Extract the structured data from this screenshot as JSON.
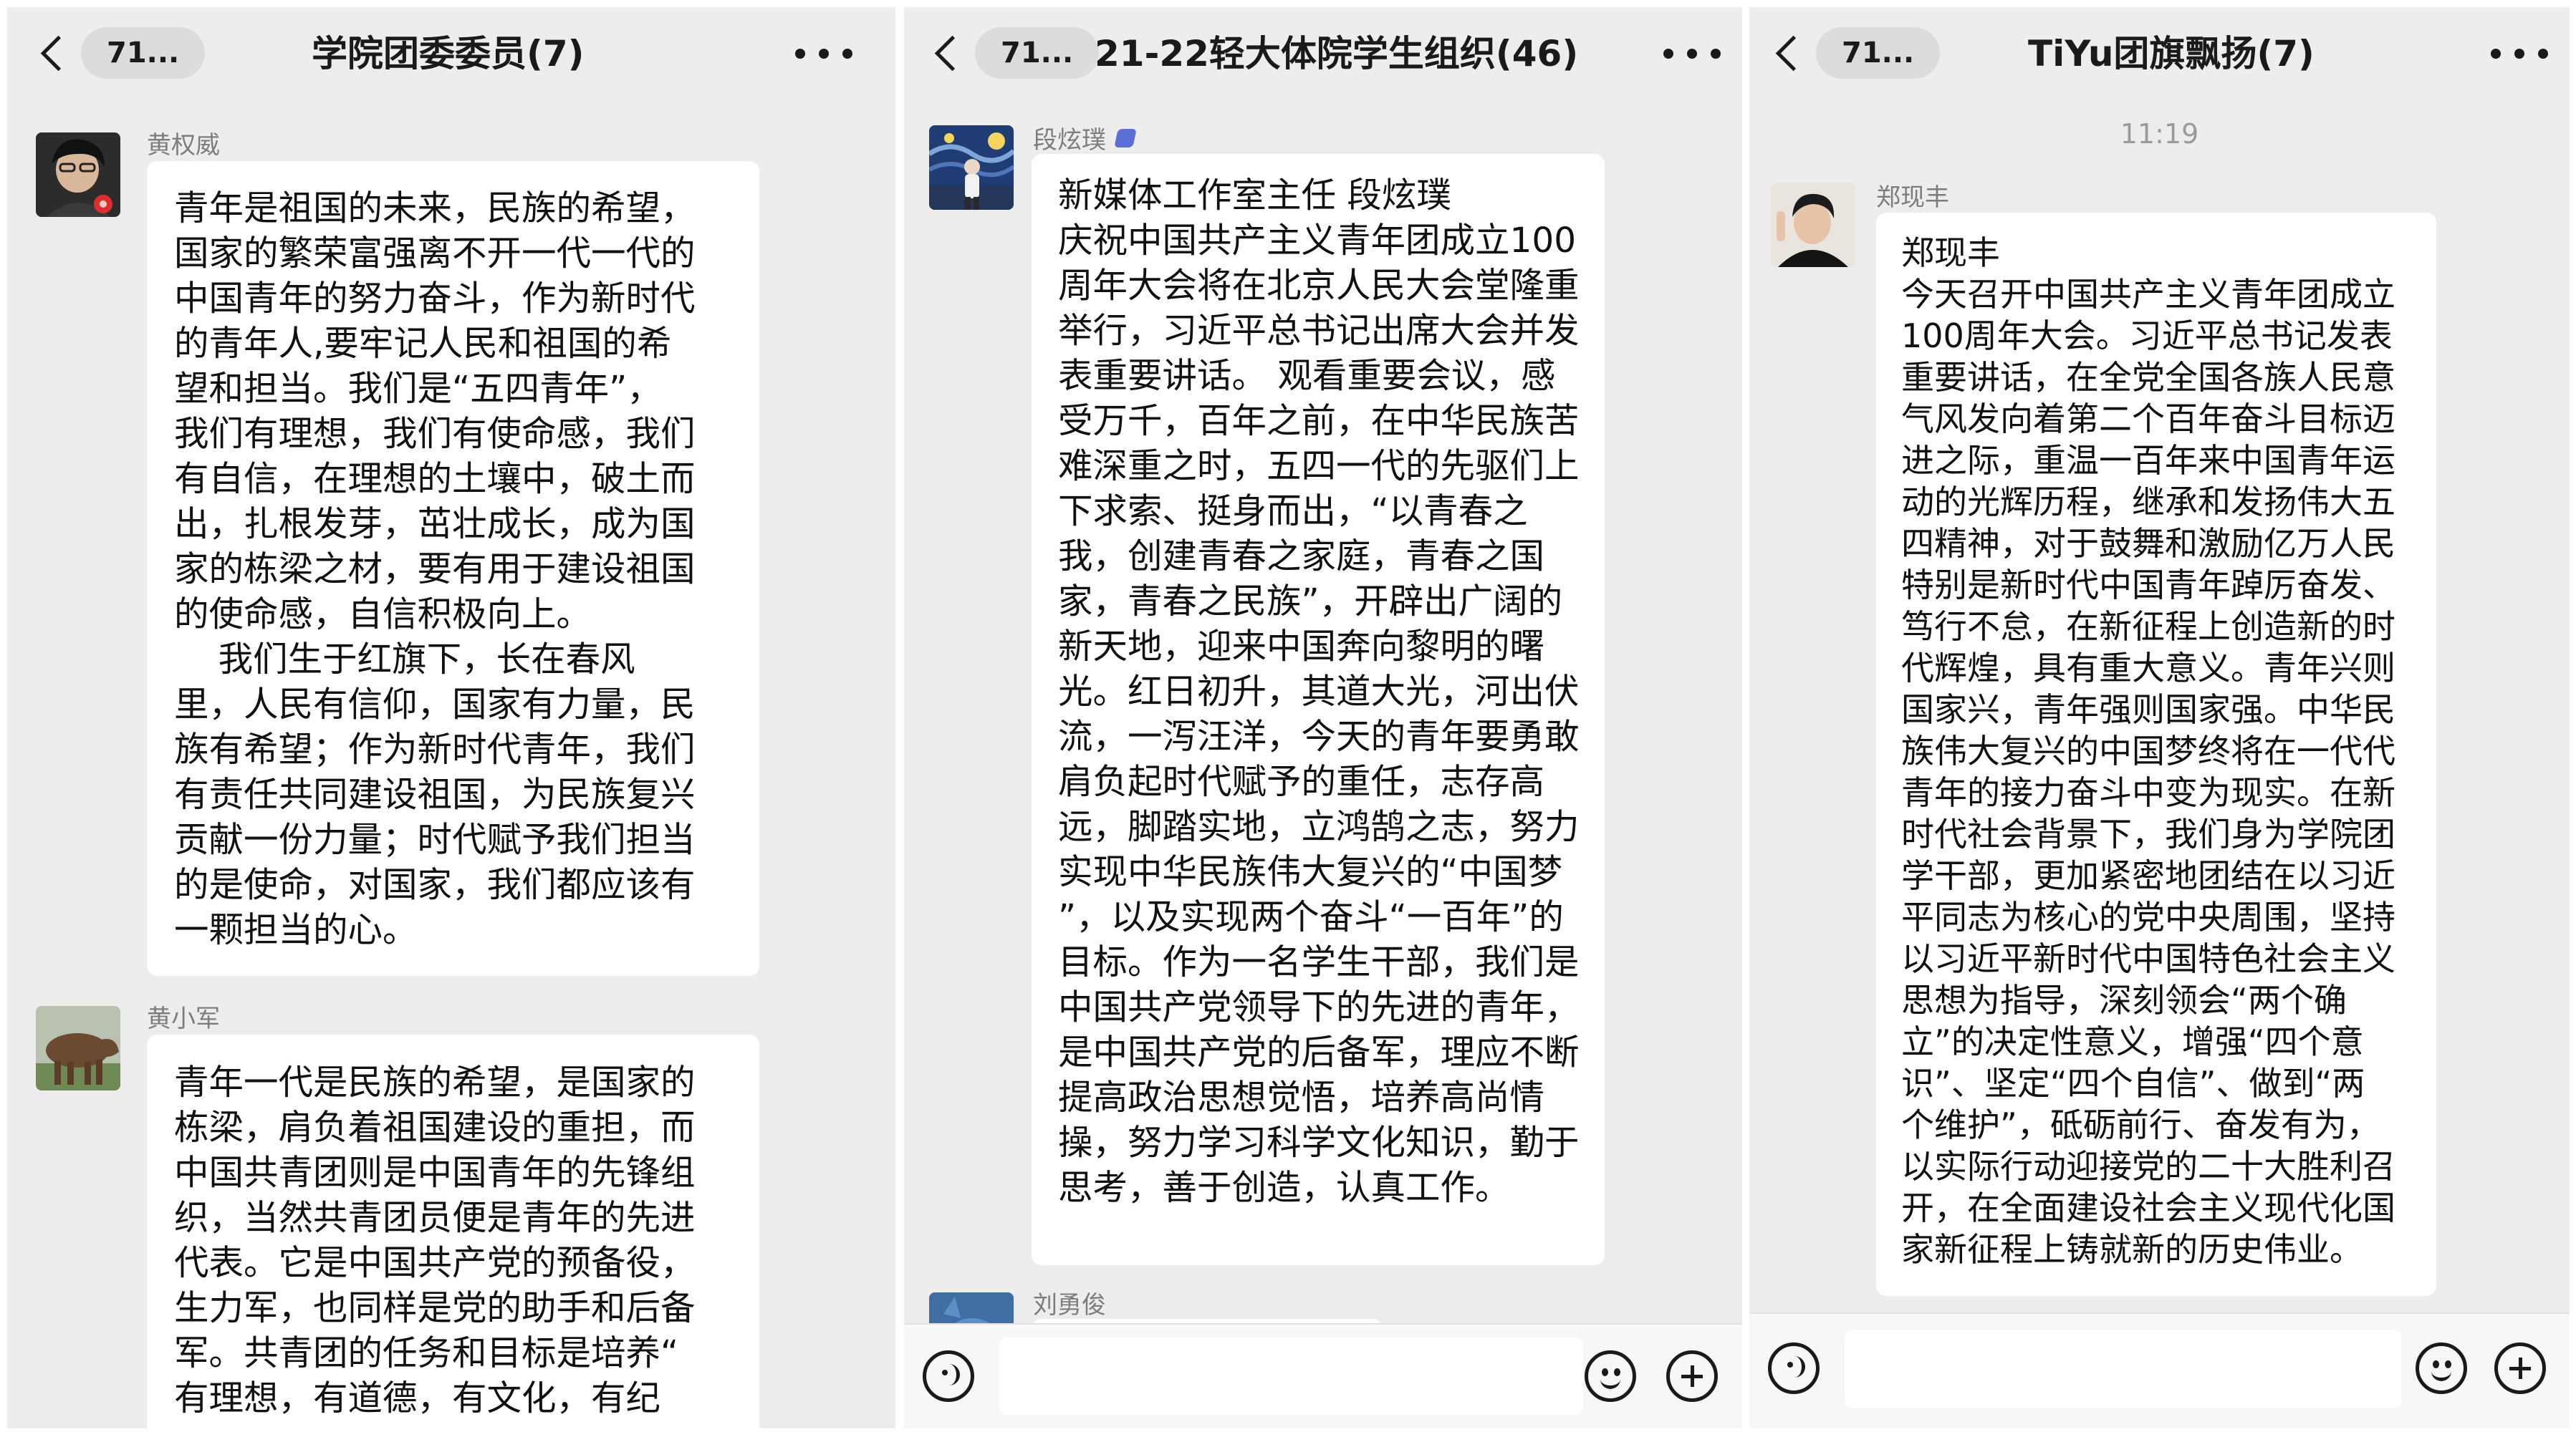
{
  "panels": [
    {
      "back_count": "71...",
      "title": "学院团委委员(7)",
      "messages": [
        {
          "sender": "黄权威",
          "avatar_icon": "person-avatar-dark",
          "text": "青年是祖国的未来，民族的希望，\n国家的繁荣富强离不开一代一代的\n中国青年的努力奋斗，作为新时代\n的青年人,要牢记人民和祖国的希\n望和担当。我们是“五四青年”，\n我们有理想，我们有使命感，我们\n有自信，在理想的土壤中，破土而\n出，扎根发芽，茁壮成长，成为国\n家的栋梁之材，要有用于建设祖国\n的使命感，自信积极向上。\n    我们生于红旗下，长在春风\n里，人民有信仰，国家有力量，民\n族有希望；作为新时代青年，我们\n有责任共同建设祖国，为民族复兴\n贡献一份力量；时代赋予我们担当\n的是使命，对国家，我们都应该有\n一颗担当的心。"
        },
        {
          "sender": "黄小军",
          "avatar_icon": "horse-avatar",
          "text": "青年一代是民族的希望，是国家的\n栋梁，肩负着祖国建设的重担，而\n中国共青团则是中国青年的先锋组\n织，当然共青团员便是青年的先进\n代表。它是中国共产党的预备役，\n生力军，也同样是党的助手和后备\n军。共青团的任务和目标是培养“\n有理想，有道德，有文化，有纪"
        }
      ]
    },
    {
      "back_count": "71...",
      "title": "21-22轻大体院学生组织(46)",
      "messages": [
        {
          "sender": "段炫璞",
          "avatar_icon": "starry-night-avatar",
          "text": "新媒体工作室主任 段炫璞\n庆祝中国共产主义青年团成立100\n周年大会将在北京人民大会堂隆重\n举行，习近平总书记出席大会并发\n表重要讲话。 观看重要会议，感\n受万千，百年之前，在中华民族苦\n难深重之时，五四一代的先驱们上\n下求索、挺身而出，“以青春之\n我，创建青春之家庭，青春之国\n家，青春之民族”，开辟出广阔的\n新天地，迎来中国奔向黎明的曙\n光。红日初升，其道大光，河出伏\n流，一泻汪洋，今天的青年要勇敢\n肩负起时代赋予的重任，志存高\n远，脚踏实地，立鸿鹄之志，努力\n实现中华民族伟大复兴的“中国梦\n”，以及实现两个奋斗“一百年”的\n目标。作为一名学生干部，我们是\n中国共产党领导下的先进的青年，\n是中国共产党的后备军，理应不断\n提高政治思想觉悟，培养高尚情\n操，努力学习科学文化知识，勤于\n思考，善于创造，认真工作。"
        },
        {
          "sender": "刘勇俊",
          "avatar_icon": "cartoon-avatar",
          "text": ""
        }
      ]
    },
    {
      "back_count": "71...",
      "title": "TiYu团旗飘扬(7)",
      "time": "11:19",
      "messages": [
        {
          "sender": "郑现丰",
          "avatar_icon": "person-avatar",
          "text": "郑现丰\n今天召开中国共产主义青年团成立\n100周年大会。习近平总书记发表\n重要讲话，在全党全国各族人民意\n气风发向着第二个百年奋斗目标迈\n进之际，重温一百年来中国青年运\n动的光辉历程，继承和发扬伟大五\n四精神，对于鼓舞和激励亿万人民\n特别是新时代中国青年踔厉奋发、\n笃行不怠，在新征程上创造新的时\n代辉煌，具有重大意义。青年兴则\n国家兴，青年强则国家强。中华民\n族伟大复兴的中国梦终将在一代代\n青年的接力奋斗中变为现实。在新\n时代社会背景下，我们身为学院团\n学干部，更加紧密地团结在以习近\n平同志为核心的党中央周围，坚持\n以习近平新时代中国特色社会主义\n思想为指导，深刻领会“两个确\n立”的决定性意义，增强“四个意\n识”、坚定“四个自信”、做到“两\n个维护”，砥砺前行、奋发有为，\n以实际行动迎接党的二十大胜利召\n开，在全面建设社会主义现代化国\n家新征程上铸就新的历史伟业。"
        }
      ]
    }
  ]
}
